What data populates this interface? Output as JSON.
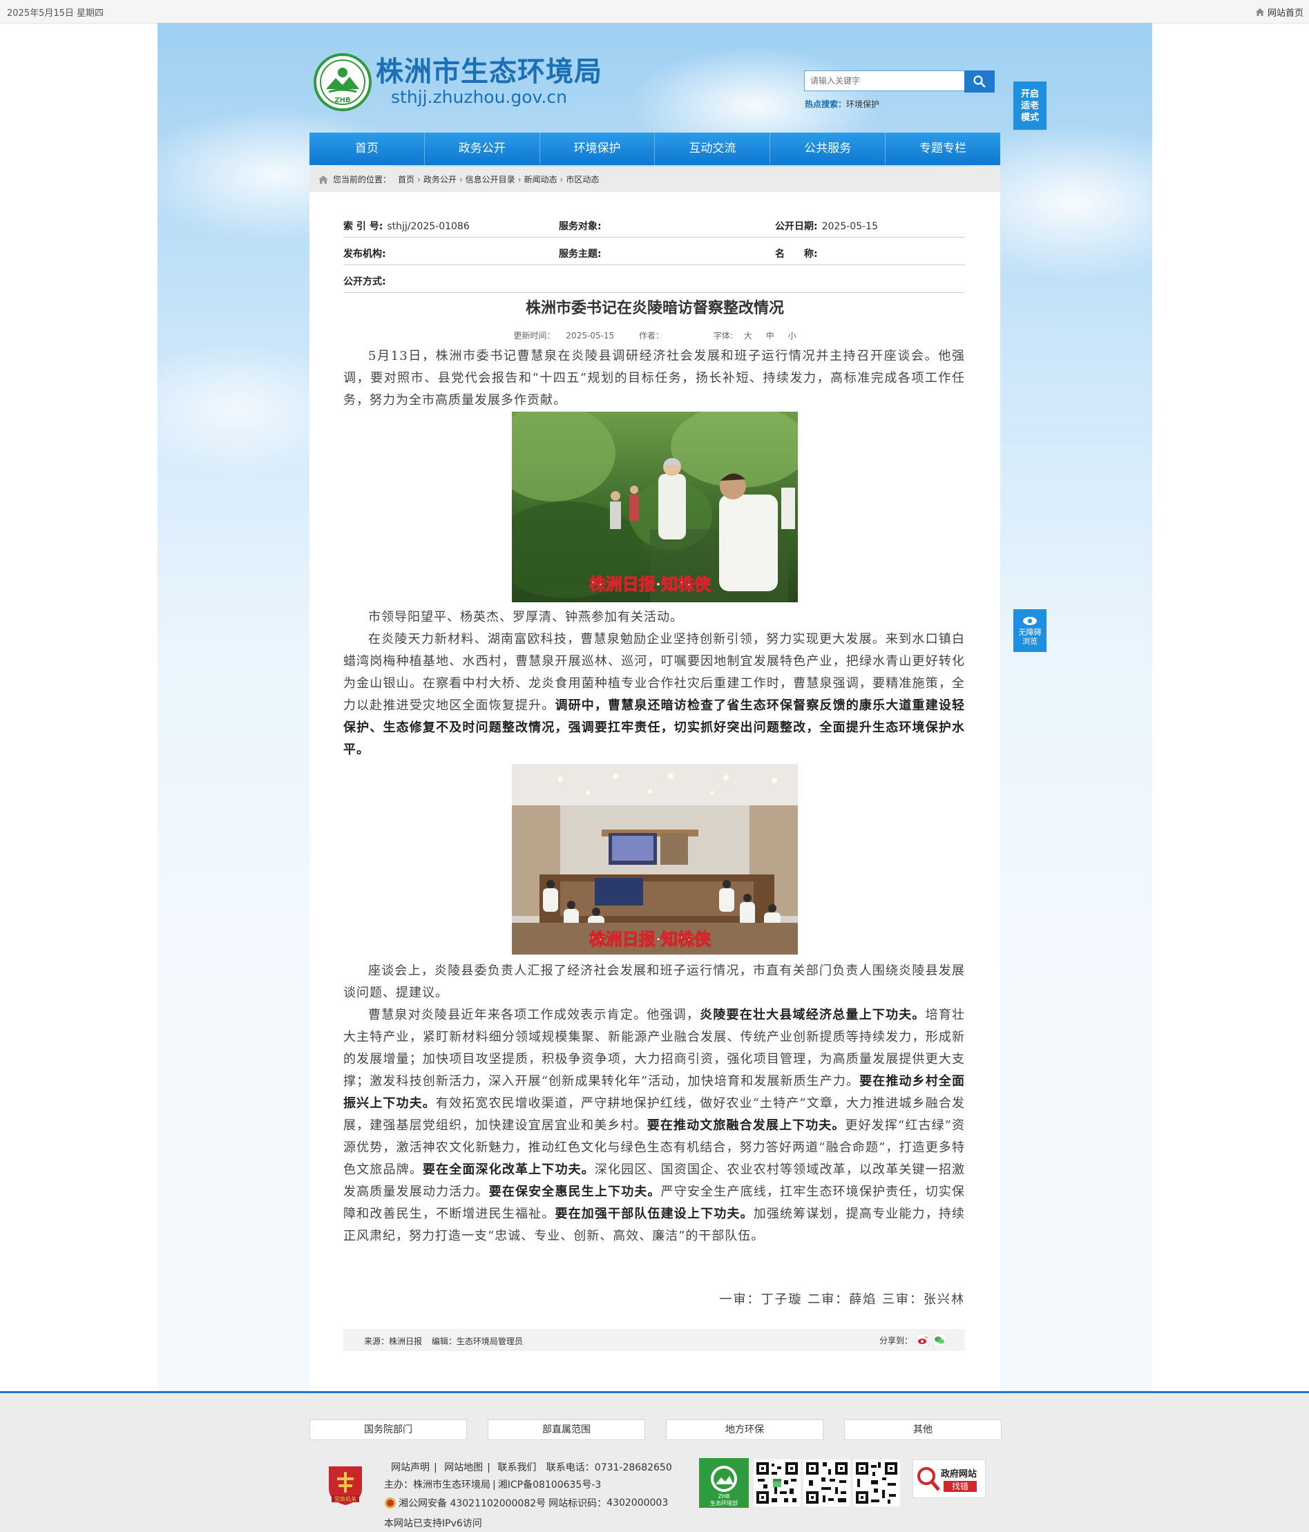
{
  "topbar": {
    "date": "2025年5月15日 星期四",
    "home_label": "网站首页"
  },
  "header": {
    "site_name": "株洲市生态环境局",
    "site_domain": "sthjj.zhuzhou.gov.cn",
    "emblem_text": "ZHB",
    "search_placeholder": "请输入关键字",
    "hot_label": "热点搜索：",
    "hot_term": "环境保护",
    "elder_mode": "开启适老模式",
    "accessible": "无障碍浏览"
  },
  "nav": [
    "首页",
    "政务公开",
    "环境保护",
    "互动交流",
    "公共服务",
    "专题专栏"
  ],
  "breadcrumb": {
    "prefix": "您当前的位置：",
    "items": [
      "首页",
      "政务公开",
      "信息公开目录",
      "新闻动态",
      "市区动态"
    ]
  },
  "meta": {
    "index_label": "索 引 号:",
    "index_value": "sthjj/2025-01086",
    "target_label": "服务对象:",
    "target_value": "",
    "date_label": "公开日期:",
    "date_value": "2025-05-15",
    "publisher_label": "发布机构:",
    "publisher_value": "",
    "topic_label": "服务主题:",
    "topic_value": "",
    "name_label": "名　　称:",
    "name_value": "",
    "mode_label": "公开方式:",
    "mode_value": ""
  },
  "article": {
    "title": "株洲市委书记在炎陵暗访督察整改情况",
    "updated_label": "更新时间：",
    "updated": "2025-05-15",
    "author_label": "作者：",
    "author": "",
    "font_label": "字体:",
    "font_sizes": [
      "大",
      "中",
      "小"
    ],
    "p1": "5月13日，株洲市委书记曹慧泉在炎陵县调研经济社会发展和班子运行情况并主持召开座谈会。他强调，要对照市、县党代会报告和“十四五”规划的目标任务，扬长补短、持续发力，高标准完成各项工作任务，努力为全市高质量发展多作贡献。",
    "watermark": "株洲日报·知株侠",
    "p2": "市领导阳望平、杨英杰、罗厚清、钟燕参加有关活动。",
    "p3a": "在炎陵天力新材料、湖南富欧科技，曹慧泉勉励企业坚持创新引领，努力实现更大发展。来到水口镇白蜡湾岗梅种植基地、水西村，曹慧泉开展巡林、巡河，叮嘱要因地制宜发展特色产业，把绿水青山更好转化为金山银山。在察看中村大桥、龙炎食用菌种植专业合作社灾后重建工作时，曹慧泉强调，要精准施策，全力以赴推进受灾地区全面恢复提升。",
    "p3b": "调研中，曹慧泉还暗访检查了省生态环保督察反馈的康乐大道重建设轻保护、生态修复不及时问题整改情况，强调要扛牢责任，切实抓好突出问题整改，全面提升生态环境保护水平。",
    "p4": "座谈会上，炎陵县委负责人汇报了经济社会发展和班子运行情况，市直有关部门负责人围绕炎陵县发展谈问题、提建议。",
    "p5a": "曹慧泉对炎陵县近年来各项工作成效表示肯定。他强调，",
    "p5b": "炎陵要在壮大县域经济总量上下功夫。",
    "p5c": "培育壮大主特产业，紧盯新材料细分领域规模集聚、新能源产业融合发展、传统产业创新提质等持续发力，形成新的发展增量；加快项目攻坚提质，积极争资争项，大力招商引资，强化项目管理，为高质量发展提供更大支撑；激发科技创新活力，深入开展“创新成果转化年”活动，加快培育和发展新质生产力。",
    "p5d": "要在推动乡村全面振兴上下功夫。",
    "p5e": "有效拓宽农民增收渠道，严守耕地保护红线，做好农业“土特产”文章，大力推进城乡融合发展，建强基层党组织，加快建设宜居宜业和美乡村。",
    "p5f": "要在推动文旅融合发展上下功夫。",
    "p5g": "更好发挥“红古绿”资源优势，激活神农文化新魅力，推动红色文化与绿色生态有机结合，努力答好两道“融合命题”，打造更多特色文旅品牌。",
    "p5h": "要在全面深化改革上下功夫。",
    "p5i": "深化园区、国资国企、农业农村等领域改革，以改革关键一招激发高质量发展动力活力。",
    "p5j": "要在保安全惠民生上下功夫。",
    "p5k": "严守安全生产底线，扛牢生态环境保护责任，切实保障和改善民生，不断增进民生福祉。",
    "p5l": "要在加强干部队伍建设上下功夫。",
    "p5m": "加强统筹谋划，提高专业能力，持续正风肃纪，努力打造一支“忠诚、专业、创新、高效、廉洁”的干部队伍。",
    "review": "一审：丁子璇 二审：薛焰 三审：张兴林",
    "source_label": "来源：",
    "source": "株洲日报",
    "editor_label": "编辑：",
    "editor": "生态环境局管理员",
    "share_label": "分享到："
  },
  "footer": {
    "links": [
      "国务院部门",
      "部直属范围",
      "地方环保",
      "其他"
    ],
    "nav": [
      "网站声明",
      "网站地图",
      "联系我们"
    ],
    "phone_label": "联系电话：",
    "phone": "0731-28682650",
    "host_label": "主办：",
    "host": "株洲市生态环境局",
    "icp": "湘ICP备08100635号-3",
    "police": "湘公网安备 43021102000082号",
    "site_id_label": "网站标识码：",
    "site_id": "4302000003",
    "ipv6": "本网站已支持IPv6访问",
    "badge_text": "党政机关",
    "zhb_text": "ZHB",
    "zhb_caption": "生态环境部",
    "error_title": "政府网站",
    "error_sub": "找错"
  },
  "colors": {
    "primary": "#1f79cc",
    "nav_top": "#2a9bea",
    "brand": "#1a6fb5"
  }
}
